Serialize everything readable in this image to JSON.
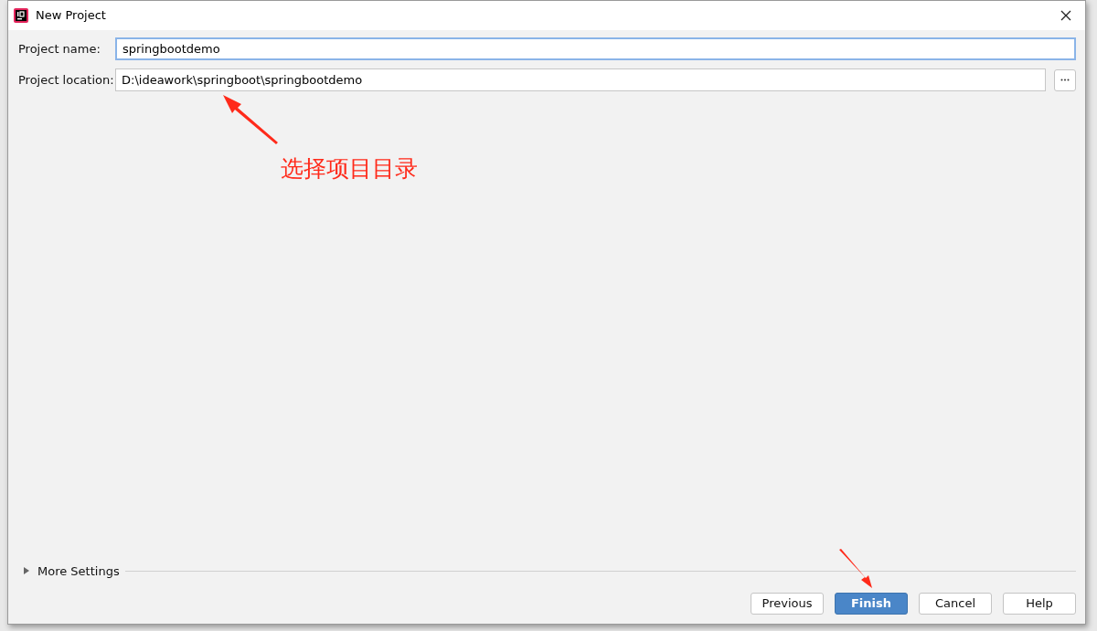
{
  "window": {
    "title": "New Project"
  },
  "fields": [
    {
      "label": "Project name:",
      "value": "springbootdemo",
      "focused": true,
      "browse": false
    },
    {
      "label": "Project location:",
      "value": "D:\\ideawork\\springboot\\springbootdemo",
      "focused": false,
      "browse": true
    }
  ],
  "more_settings": {
    "label": "More Settings",
    "expanded": false
  },
  "buttons": [
    {
      "label": "Previous",
      "primary": false
    },
    {
      "label": "Finish",
      "primary": true
    },
    {
      "label": "Cancel",
      "primary": false
    },
    {
      "label": "Help",
      "primary": false
    }
  ],
  "annotation": {
    "text": "选择项目目录"
  }
}
